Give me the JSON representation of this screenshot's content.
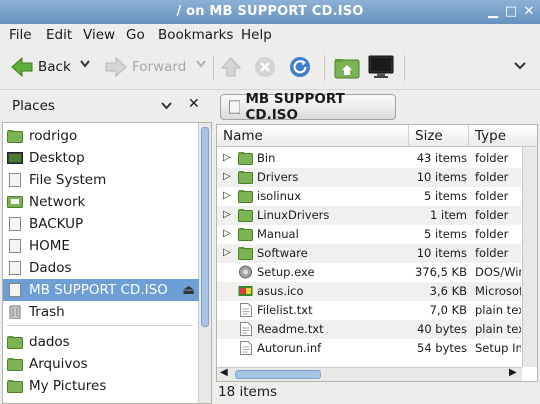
{
  "window": {
    "title": "/ on MB SUPPORT CD.ISO"
  },
  "menu": [
    "File",
    "Edit",
    "View",
    "Go",
    "Bookmarks",
    "Help"
  ],
  "toolbar": {
    "back_label": "Back",
    "forward_label": "Forward"
  },
  "places": {
    "header": "Places",
    "items": [
      {
        "label": "rodrigo",
        "icon": "home-folder-icon"
      },
      {
        "label": "Desktop",
        "icon": "desktop-icon"
      },
      {
        "label": "File System",
        "icon": "drive-icon"
      },
      {
        "label": "Network",
        "icon": "network-icon"
      },
      {
        "label": "BACKUP",
        "icon": "drive-icon"
      },
      {
        "label": "HOME",
        "icon": "drive-icon"
      },
      {
        "label": "Dados",
        "icon": "drive-icon"
      },
      {
        "label": "MB SUPPORT CD.ISO",
        "icon": "drive-icon"
      },
      {
        "label": "Trash",
        "icon": "trash-icon"
      },
      {
        "label": "dados",
        "icon": "folder-icon"
      },
      {
        "label": "Arquivos",
        "icon": "folder-icon"
      },
      {
        "label": "My Pictures",
        "icon": "folder-icon"
      }
    ]
  },
  "path": {
    "current": "MB SUPPORT CD.ISO"
  },
  "columns": {
    "name": "Name",
    "size": "Size",
    "type": "Type"
  },
  "files": [
    {
      "name": "Bin",
      "size": "43 items",
      "type": "folder",
      "kind": "folder"
    },
    {
      "name": "Drivers",
      "size": "10 items",
      "type": "folder",
      "kind": "folder"
    },
    {
      "name": "isolinux",
      "size": "5 items",
      "type": "folder",
      "kind": "folder"
    },
    {
      "name": "LinuxDrivers",
      "size": "1 item",
      "type": "folder",
      "kind": "folder"
    },
    {
      "name": "Manual",
      "size": "5 items",
      "type": "folder",
      "kind": "folder"
    },
    {
      "name": "Software",
      "size": "10 items",
      "type": "folder",
      "kind": "folder"
    },
    {
      "name": "Setup.exe",
      "size": "376,5 KB",
      "type": "DOS/Win",
      "kind": "exe"
    },
    {
      "name": "asus.ico",
      "size": "3,6 KB",
      "type": "Microsoft",
      "kind": "ico"
    },
    {
      "name": "Filelist.txt",
      "size": "7,0 KB",
      "type": "plain text",
      "kind": "text"
    },
    {
      "name": "Readme.txt",
      "size": "40 bytes",
      "type": "plain text",
      "kind": "text"
    },
    {
      "name": "Autorun.inf",
      "size": "54 bytes",
      "type": "Setup Inf",
      "kind": "text"
    }
  ],
  "status": {
    "text": "18 items"
  },
  "colors": {
    "selection": "#6d9ed6",
    "titlebar": "#7aa2cb",
    "folder": "#6fa246"
  }
}
